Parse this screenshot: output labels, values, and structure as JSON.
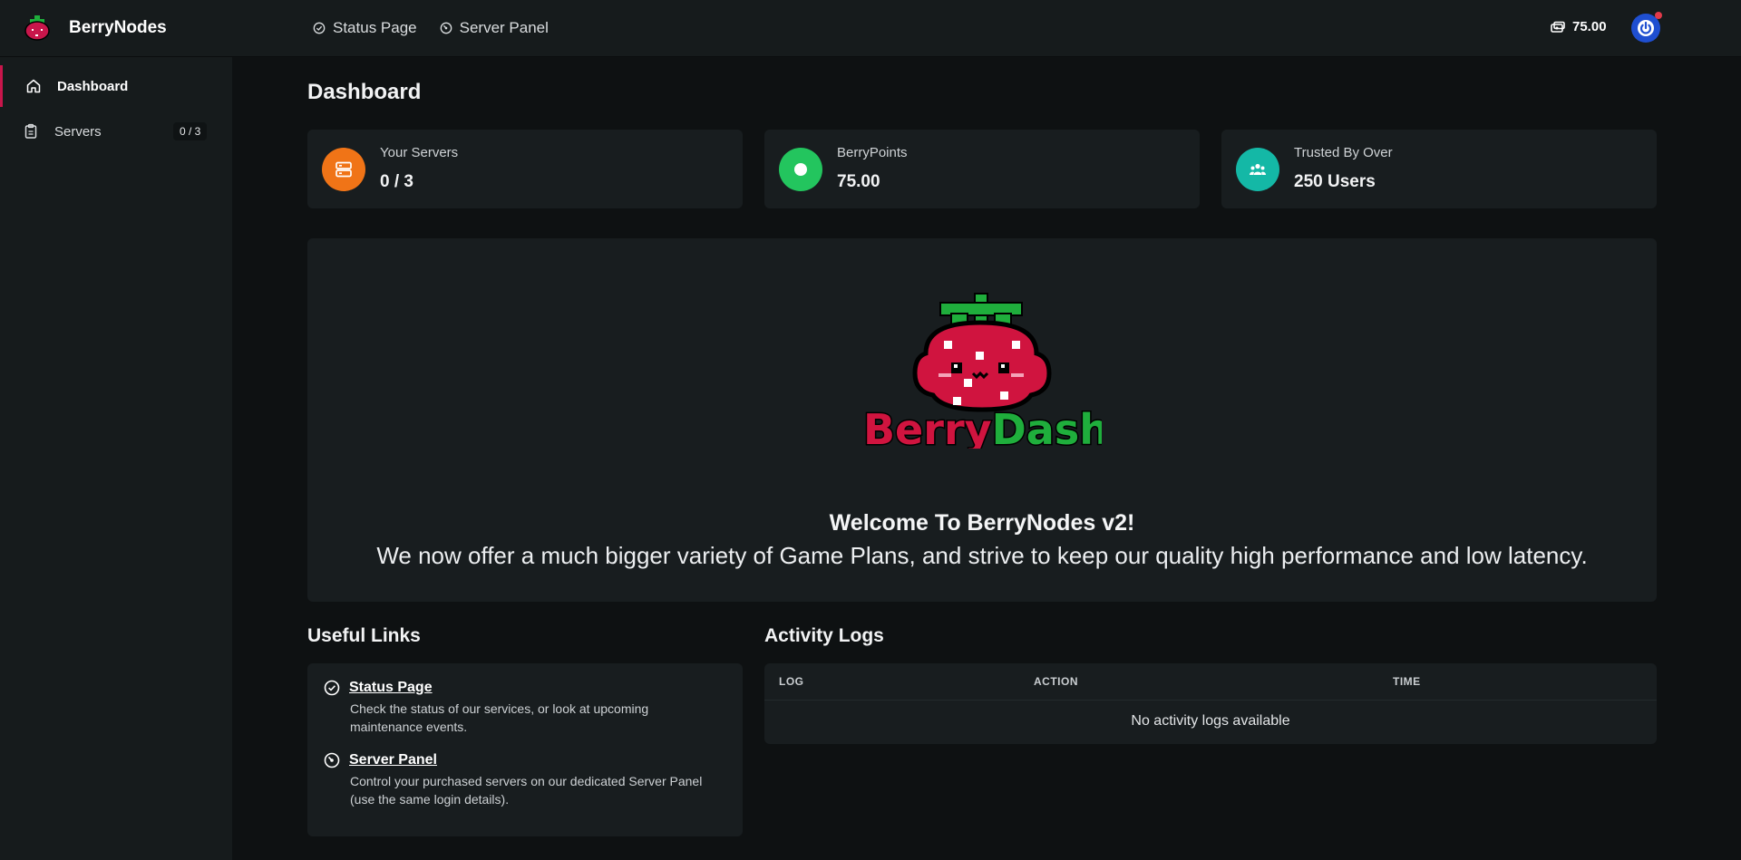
{
  "brand": {
    "name": "BerryNodes"
  },
  "topnav": [
    {
      "label": "Status Page",
      "icon": "check-circle-icon"
    },
    {
      "label": "Server Panel",
      "icon": "gauge-icon"
    }
  ],
  "header": {
    "balance": "75.00",
    "balance_icon": "coins-icon"
  },
  "sidebar": {
    "items": [
      {
        "label": "Dashboard",
        "icon": "home-icon",
        "active": true
      },
      {
        "label": "Servers",
        "icon": "clipboard-icon",
        "badge": "0 / 3"
      }
    ]
  },
  "main": {
    "title": "Dashboard",
    "stats": [
      {
        "label": "Your Servers",
        "value": "0 / 3",
        "color": "#f07417",
        "icon": "server-icon"
      },
      {
        "label": "BerryPoints",
        "value": "75.00",
        "color": "#23c55e",
        "icon": "dot-icon"
      },
      {
        "label": "Trusted By Over",
        "value": "250 Users",
        "color": "#14b8a6",
        "icon": "users-icon"
      }
    ],
    "hero": {
      "logo_text": "BerryDash",
      "heading": "Welcome To BerryNodes v2!",
      "text": "We now offer a much bigger variety of Game Plans, and strive to keep our quality high performance and low latency."
    },
    "useful_links": {
      "title": "Useful Links",
      "items": [
        {
          "title": "Status Page",
          "desc": "Check the status of our services, or look at upcoming maintenance events.",
          "icon": "check-circle-icon"
        },
        {
          "title": "Server Panel",
          "desc": "Control your purchased servers on our dedicated Server Panel (use the same login details).",
          "icon": "gauge-icon"
        }
      ]
    },
    "activity_logs": {
      "title": "Activity Logs",
      "columns": [
        "LOG",
        "ACTION",
        "TIME"
      ],
      "empty": "No activity logs available"
    }
  },
  "colors": {
    "accent": "#c8164b",
    "berry_red": "#d0143f",
    "leaf_green": "#1fae3c",
    "power_blue": "#1f4fd1"
  }
}
